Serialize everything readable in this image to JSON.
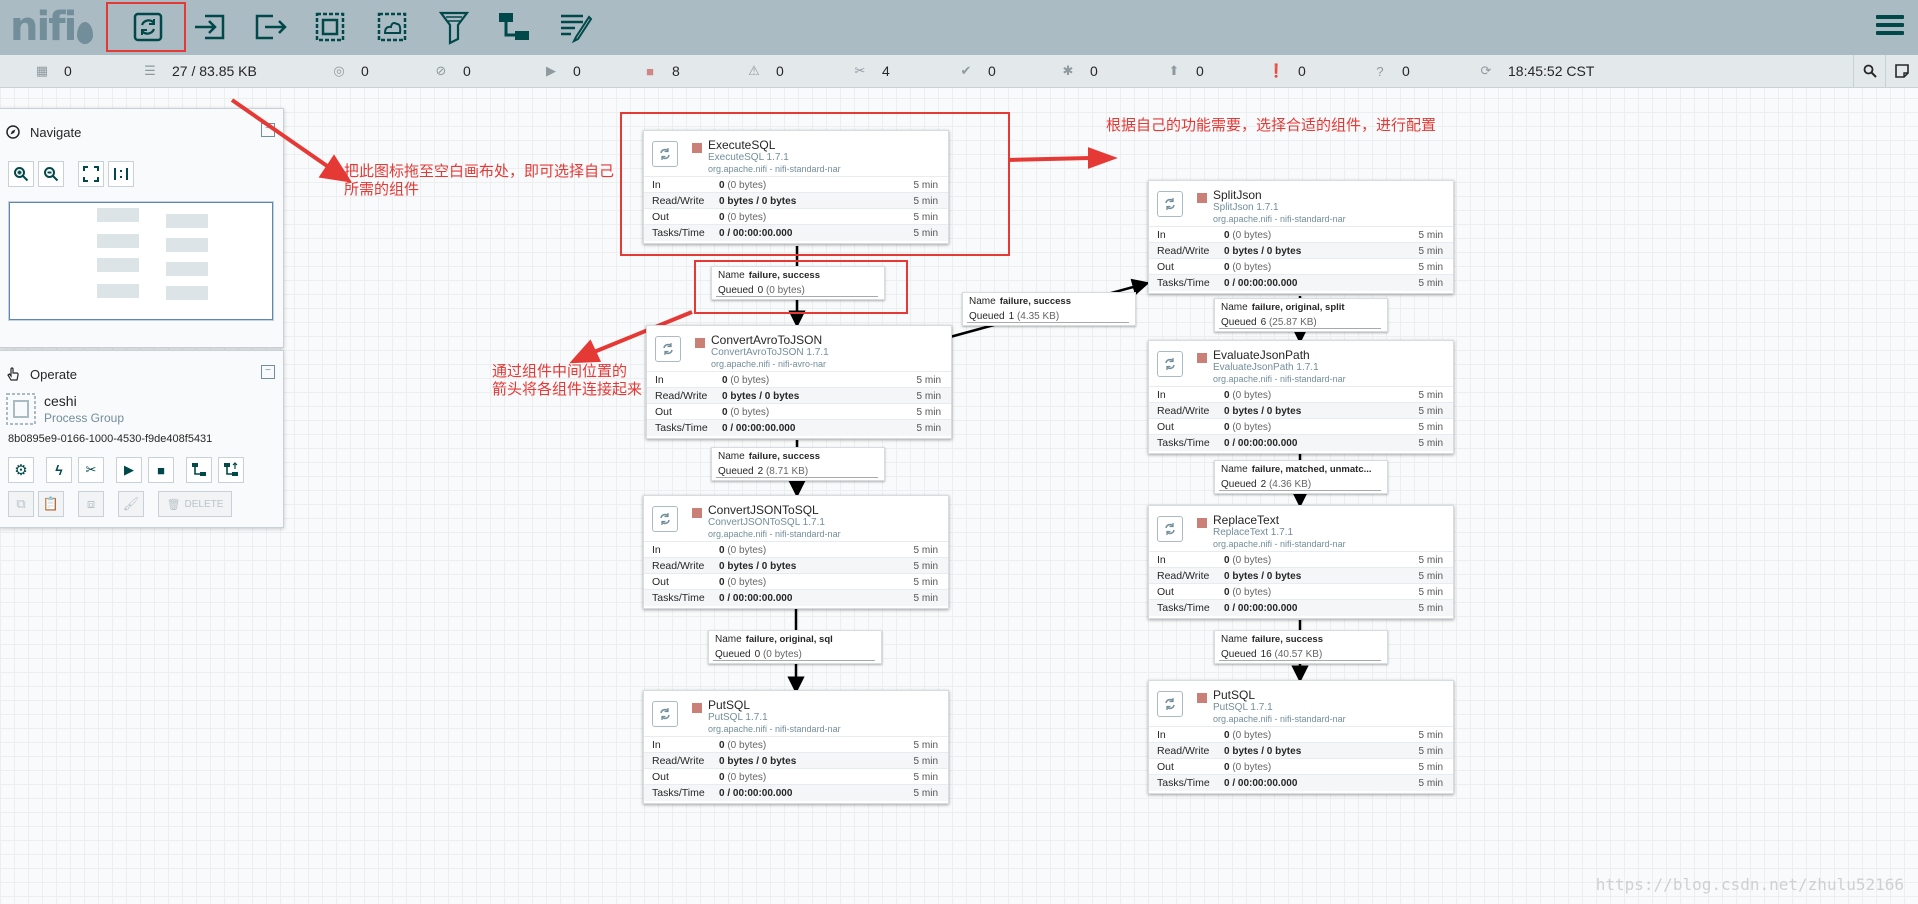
{
  "app": {
    "logo_text": "nifi",
    "current_time": "18:45:52 CST"
  },
  "toolbar": {
    "components": [
      "processor-icon",
      "input-port-icon",
      "output-port-icon",
      "process-group-icon",
      "remote-process-group-icon",
      "funnel-icon",
      "template-icon",
      "label-icon"
    ]
  },
  "status": {
    "active_threads": "0",
    "queued": "27 / 83.85 KB",
    "transmitting": "0",
    "not_transmitting": "0",
    "running": "0",
    "stopped": "8",
    "invalid": "0",
    "disabled": "4",
    "up_to_date": "0",
    "locally_modified": "0",
    "stale": "0",
    "locally_modified_stale": "0",
    "sync_failure": "0"
  },
  "navigate": {
    "title": "Navigate"
  },
  "operate": {
    "title": "Operate",
    "name": "ceshi",
    "type": "Process Group",
    "id": "8b0895e9-0166-1000-4530-f9de408f5431",
    "delete_label": "DELETE"
  },
  "processors": [
    {
      "name": "ExecuteSQL",
      "type": "ExecuteSQL 1.7.1",
      "bundle": "org.apache.nifi - nifi-standard-nar",
      "in": "0",
      "in_bytes": "(0 bytes)",
      "rw": "0 bytes / 0 bytes",
      "out": "0",
      "out_bytes": "(0 bytes)",
      "tasks": "0 / 00:00:00.000",
      "window": "5 min"
    },
    {
      "name": "ConvertAvroToJSON",
      "type": "ConvertAvroToJSON 1.7.1",
      "bundle": "org.apache.nifi - nifi-avro-nar",
      "in": "0",
      "in_bytes": "(0 bytes)",
      "rw": "0 bytes / 0 bytes",
      "out": "0",
      "out_bytes": "(0 bytes)",
      "tasks": "0 / 00:00:00.000",
      "window": "5 min"
    },
    {
      "name": "ConvertJSONToSQL",
      "type": "ConvertJSONToSQL 1.7.1",
      "bundle": "org.apache.nifi - nifi-standard-nar",
      "in": "0",
      "in_bytes": "(0 bytes)",
      "rw": "0 bytes / 0 bytes",
      "out": "0",
      "out_bytes": "(0 bytes)",
      "tasks": "0 / 00:00:00.000",
      "window": "5 min"
    },
    {
      "name": "PutSQL",
      "type": "PutSQL 1.7.1",
      "bundle": "org.apache.nifi - nifi-standard-nar",
      "in": "0",
      "in_bytes": "(0 bytes)",
      "rw": "0 bytes / 0 bytes",
      "out": "0",
      "out_bytes": "(0 bytes)",
      "tasks": "0 / 00:00:00.000",
      "window": "5 min"
    },
    {
      "name": "SplitJson",
      "type": "SplitJson 1.7.1",
      "bundle": "org.apache.nifi - nifi-standard-nar",
      "in": "0",
      "in_bytes": "(0 bytes)",
      "rw": "0 bytes / 0 bytes",
      "out": "0",
      "out_bytes": "(0 bytes)",
      "tasks": "0 / 00:00:00.000",
      "window": "5 min"
    },
    {
      "name": "EvaluateJsonPath",
      "type": "EvaluateJsonPath 1.7.1",
      "bundle": "org.apache.nifi - nifi-standard-nar",
      "in": "0",
      "in_bytes": "(0 bytes)",
      "rw": "0 bytes / 0 bytes",
      "out": "0",
      "out_bytes": "(0 bytes)",
      "tasks": "0 / 00:00:00.000",
      "window": "5 min"
    },
    {
      "name": "ReplaceText",
      "type": "ReplaceText 1.7.1",
      "bundle": "org.apache.nifi - nifi-standard-nar",
      "in": "0",
      "in_bytes": "(0 bytes)",
      "rw": "0 bytes / 0 bytes",
      "out": "0",
      "out_bytes": "(0 bytes)",
      "tasks": "0 / 00:00:00.000",
      "window": "5 min"
    },
    {
      "name": "PutSQL",
      "type": "PutSQL 1.7.1",
      "bundle": "org.apache.nifi - nifi-standard-nar",
      "in": "0",
      "in_bytes": "(0 bytes)",
      "rw": "0 bytes / 0 bytes",
      "out": "0",
      "out_bytes": "(0 bytes)",
      "tasks": "0 / 00:00:00.000",
      "window": "5 min"
    }
  ],
  "row_labels": {
    "in": "In",
    "rw": "Read/Write",
    "out": "Out",
    "tasks": "Tasks/Time"
  },
  "conn_labels": {
    "name": "Name",
    "queued": "Queued"
  },
  "connections": [
    {
      "name": "failure, success",
      "queued": "0",
      "queued_bytes": "(0 bytes)"
    },
    {
      "name": "failure, success",
      "queued": "2",
      "queued_bytes": "(8.71 KB)"
    },
    {
      "name": "failure, original, sql",
      "queued": "0",
      "queued_bytes": "(0 bytes)"
    },
    {
      "name": "failure, success",
      "queued": "1",
      "queued_bytes": "(4.35 KB)"
    },
    {
      "name": "failure, original, split",
      "queued": "6",
      "queued_bytes": "(25.87 KB)"
    },
    {
      "name": "failure, matched, unmatc...",
      "queued": "2",
      "queued_bytes": "(4.36 KB)"
    },
    {
      "name": "failure, success",
      "queued": "16",
      "queued_bytes": "(40.57 KB)"
    }
  ],
  "annotations": {
    "drag_hint_1": "把此图标拖至空白画布处，即可选择自己",
    "drag_hint_2": "所需的组件",
    "config_hint": "根据自己的功能需要，选择合适的组件，进行配置",
    "connect_hint_1": "通过组件中间位置的",
    "connect_hint_2": "箭头将各组件连接起来"
  },
  "watermark": "https://blog.csdn.net/zhulu52166",
  "colors": {
    "header": "#aabbc3",
    "brand": "#004849",
    "stopped": "#ba554a",
    "annotation": "#e53935"
  }
}
